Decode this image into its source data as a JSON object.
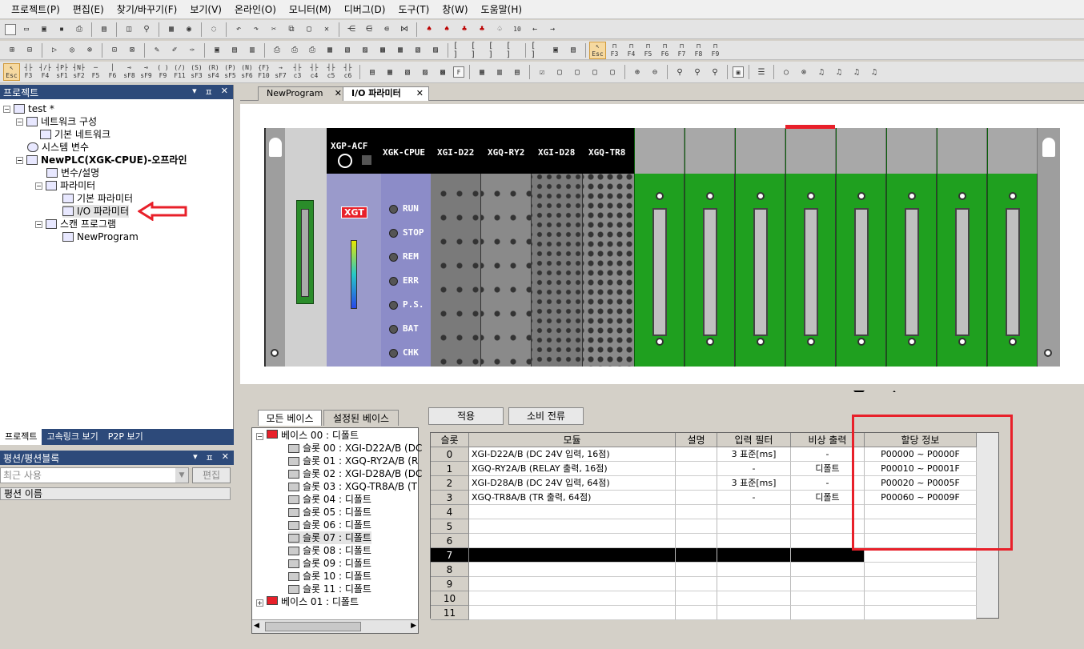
{
  "menu": [
    "프로젝트(P)",
    "편집(E)",
    "찾기/바꾸기(F)",
    "보기(V)",
    "온라인(O)",
    "모니터(M)",
    "디버그(D)",
    "도구(T)",
    "창(W)",
    "도움말(H)"
  ],
  "toolbar2_right": [
    "10",
    "↦11",
    "←",
    "→"
  ],
  "ladder_keys": [
    "Esc",
    "F3",
    "F4",
    "sF1",
    "sF2",
    "F5",
    "F6",
    "sF8",
    "sF9",
    "F9",
    "F11",
    "sF3",
    "sF4",
    "sF5",
    "sF6",
    "F10",
    "sF7",
    "c3",
    "c4",
    "c5",
    "c6"
  ],
  "func_keys": [
    "Esc",
    "F3",
    "F4",
    "F5",
    "F6",
    "F7",
    "F8",
    "F9"
  ],
  "project_panel": {
    "title": "프로젝트",
    "controls": [
      "▾",
      "ㅍ",
      "✕"
    ],
    "tree": [
      {
        "label": "test *",
        "level": 0
      },
      {
        "label": "네트워크 구성",
        "level": 1
      },
      {
        "label": "기본 네트워크",
        "level": 2
      },
      {
        "label": "시스템 변수",
        "level": 1
      },
      {
        "label": "NewPLC(XGK-CPUE)-오프라인",
        "level": 1
      },
      {
        "label": "변수/설명",
        "level": 2
      },
      {
        "label": "파라미터",
        "level": 2
      },
      {
        "label": "기본 파라미터",
        "level": 3
      },
      {
        "label": "I/O 파라미터",
        "level": 3
      },
      {
        "label": "스캔 프로그램",
        "level": 2
      },
      {
        "label": "NewProgram",
        "level": 3
      }
    ]
  },
  "left_tabs": [
    "프로젝트",
    "고속링크 보기",
    "P2P 보기"
  ],
  "pyeong_panel": {
    "title": "평션/평션블록",
    "recent": "최근 사용",
    "edit": "편집",
    "col": "평션 이름"
  },
  "doc_tabs": [
    "NewProgram",
    "I/O 파라미터"
  ],
  "rack": {
    "power": "XGP-ACF",
    "cpu": "XGK-CPUE",
    "slots": [
      "XGI-D22",
      "XGQ-RY2",
      "XGI-D28",
      "XGQ-TR8"
    ],
    "logo": "XGT",
    "leds": [
      "RUN",
      "STOP",
      "REM",
      "ERR",
      "P.S.",
      "BAT",
      "CHK"
    ]
  },
  "lower": {
    "tab_all": "모든 베이스",
    "tab_set": "설정된 베이스",
    "apply": "적용",
    "power": "소비 전류",
    "base_tree": [
      "베이스 00 : 디폴트",
      "슬롯 00 : XGI-D22A/B (DC",
      "슬롯 01 : XGQ-RY2A/B (R",
      "슬롯 02 : XGI-D28A/B (DC",
      "슬롯 03 : XGQ-TR8A/B (T",
      "슬롯 04 : 디폴트",
      "슬롯 05 : 디폴트",
      "슬롯 06 : 디폴트",
      "슬롯 07 : 디폴트",
      "슬롯 08 : 디폴트",
      "슬롯 09 : 디폴트",
      "슬롯 10 : 디폴트",
      "슬롯 11 : 디폴트",
      "베이스 01 : 디폴트"
    ],
    "headers": [
      "슬롯",
      "모듈",
      "설명",
      "입력 필터",
      "비상 출력",
      "할당 정보"
    ],
    "rows": [
      {
        "slot": "0",
        "module": "XGI-D22A/B (DC 24V 입력, 16점)",
        "desc": "",
        "filter": "3 표준[ms]",
        "emerg": "-",
        "alloc": "P00000 ~ P0000F"
      },
      {
        "slot": "1",
        "module": "XGQ-RY2A/B (RELAY 출력, 16점)",
        "desc": "",
        "filter": "-",
        "emerg": "디폴트",
        "alloc": "P00010 ~ P0001F"
      },
      {
        "slot": "2",
        "module": "XGI-D28A/B (DC 24V 입력, 64점)",
        "desc": "",
        "filter": "3 표준[ms]",
        "emerg": "-",
        "alloc": "P00020 ~ P0005F"
      },
      {
        "slot": "3",
        "module": "XGQ-TR8A/B (TR 출력, 64점)",
        "desc": "",
        "filter": "-",
        "emerg": "디폴트",
        "alloc": "P00060 ~ P0009F"
      },
      {
        "slot": "4",
        "module": "",
        "desc": "",
        "filter": "",
        "emerg": "",
        "alloc": ""
      },
      {
        "slot": "5",
        "module": "",
        "desc": "",
        "filter": "",
        "emerg": "",
        "alloc": ""
      },
      {
        "slot": "6",
        "module": "",
        "desc": "",
        "filter": "",
        "emerg": "",
        "alloc": ""
      },
      {
        "slot": "7",
        "module": "",
        "desc": "",
        "filter": "",
        "emerg": "",
        "alloc": ""
      },
      {
        "slot": "8",
        "module": "",
        "desc": "",
        "filter": "",
        "emerg": "",
        "alloc": ""
      },
      {
        "slot": "9",
        "module": "",
        "desc": "",
        "filter": "",
        "emerg": "",
        "alloc": ""
      },
      {
        "slot": "10",
        "module": "",
        "desc": "",
        "filter": "",
        "emerg": "",
        "alloc": ""
      },
      {
        "slot": "11",
        "module": "",
        "desc": "",
        "filter": "",
        "emerg": "",
        "alloc": ""
      }
    ]
  },
  "colors": {
    "panel_head": "#2d4a7a",
    "rack_green": "#1fa01f",
    "power": "#9a9acb",
    "cpu": "#8c8cc8",
    "highlight": "#e8202a"
  }
}
